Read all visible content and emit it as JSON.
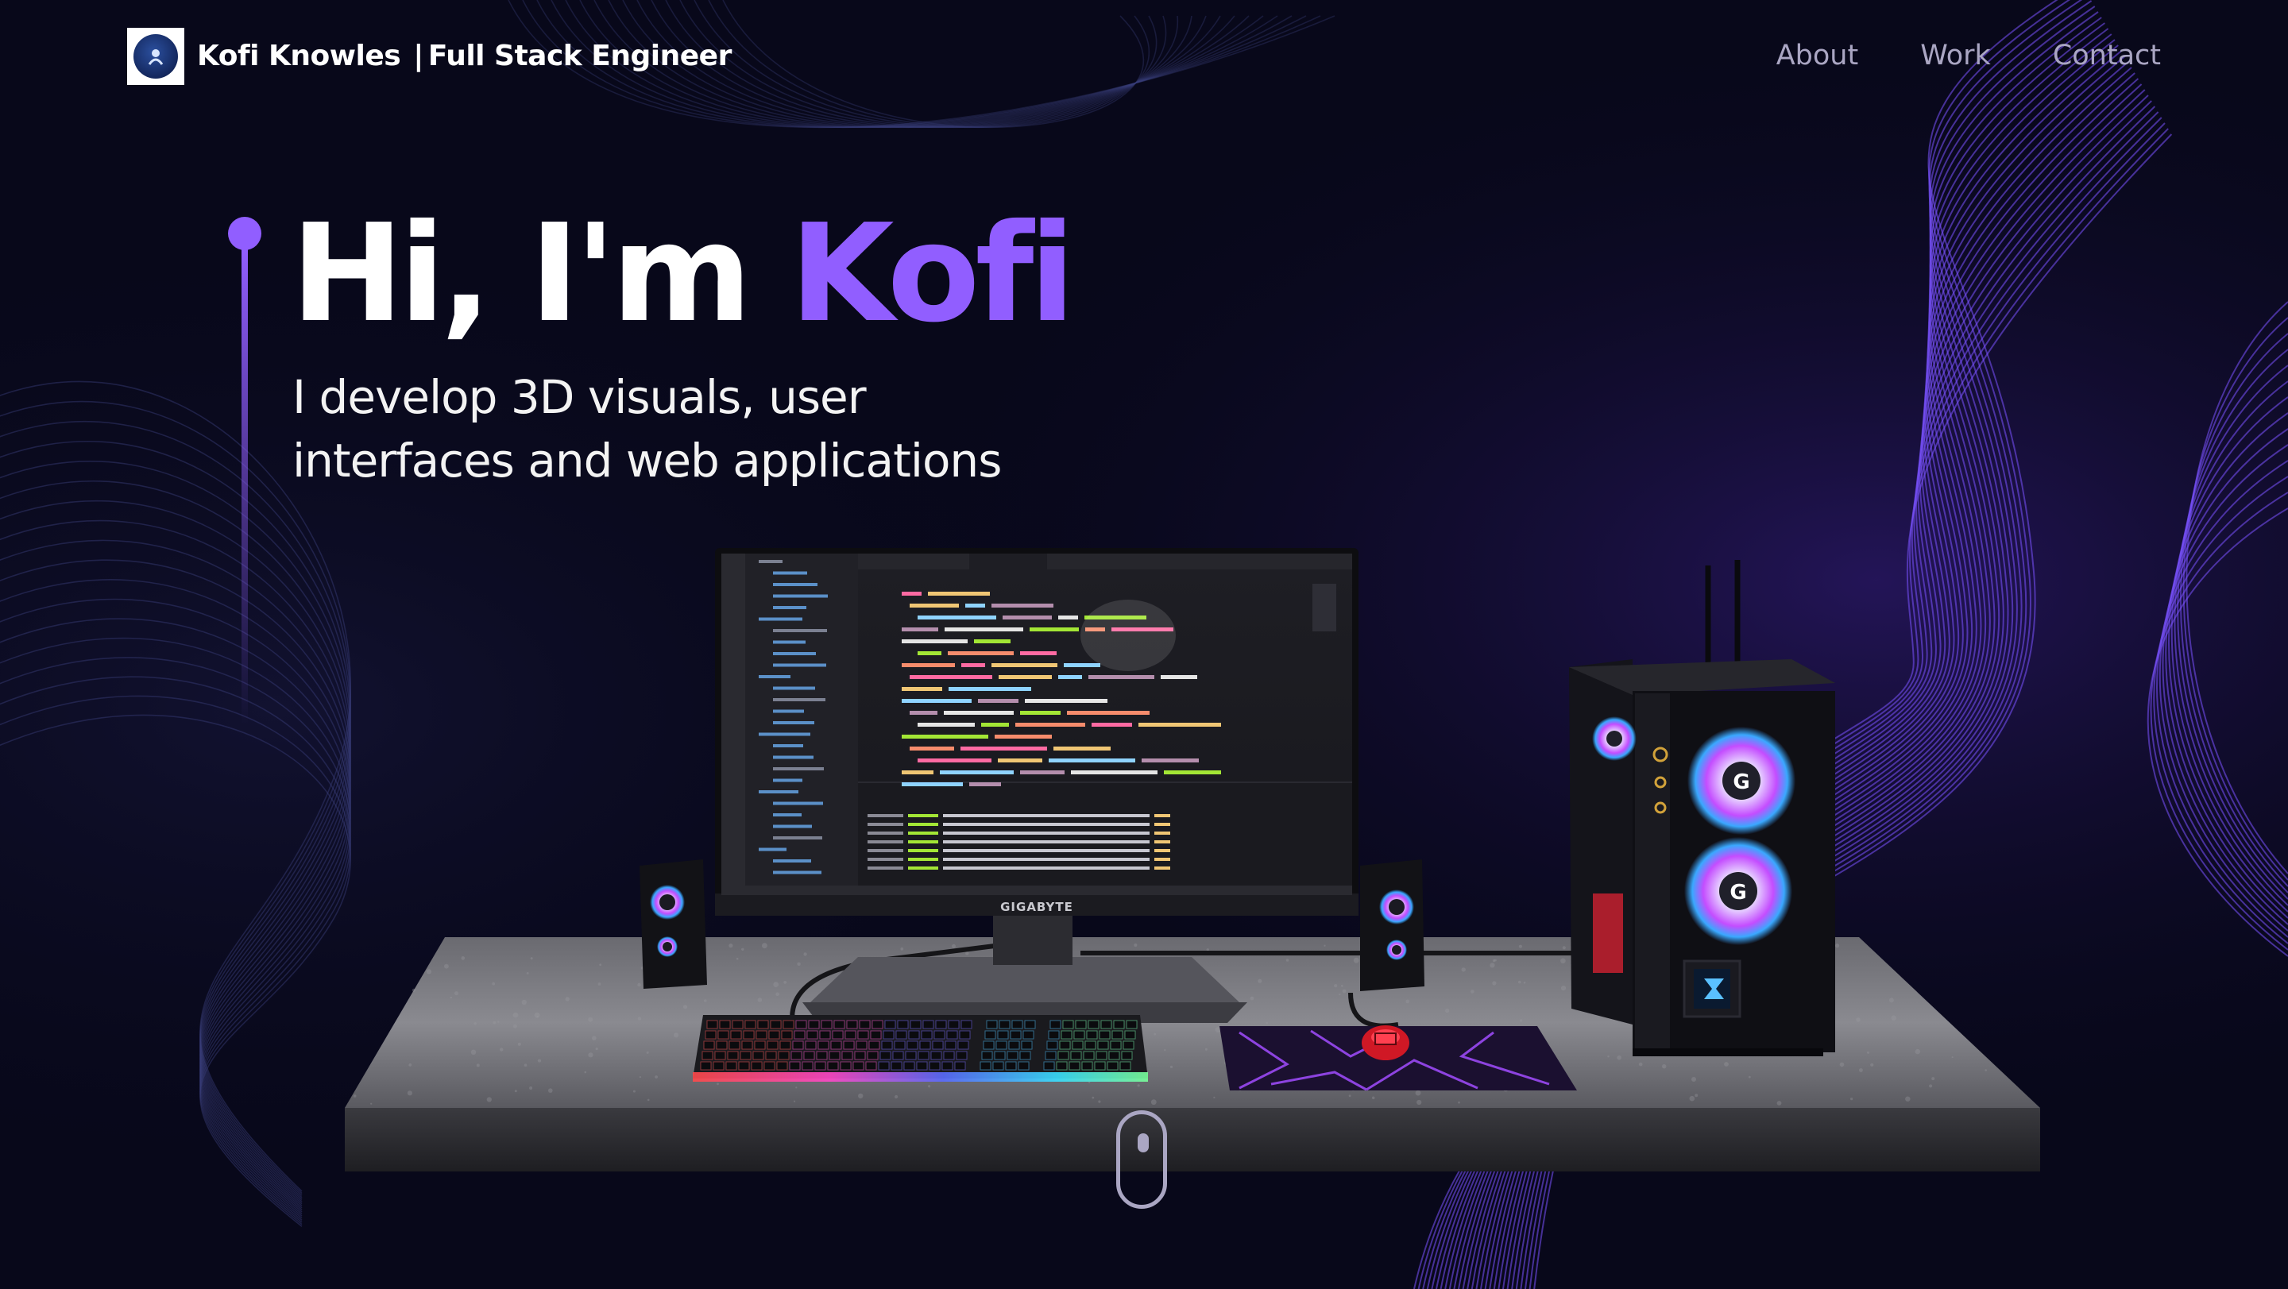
{
  "nav": {
    "name": "Kofi Knowles",
    "separator": "|",
    "role": "Full Stack Engineer",
    "links": [
      {
        "label": "About"
      },
      {
        "label": "Work"
      },
      {
        "label": "Contact"
      }
    ]
  },
  "hero": {
    "title_prefix": "Hi, I'm ",
    "title_name": "Kofi",
    "subtitle_line1": "I develop 3D visuals, user",
    "subtitle_line2": "interfaces and web applications"
  },
  "scene": {
    "monitor_brand": "GIGABYTE"
  },
  "colors": {
    "background": "#08081a",
    "accent": "#915eff",
    "nav_text": "#aaa6c3",
    "text": "#ffffff"
  },
  "icons": {
    "logo": "logo-icon",
    "scroll": "mouse-scroll-icon"
  }
}
